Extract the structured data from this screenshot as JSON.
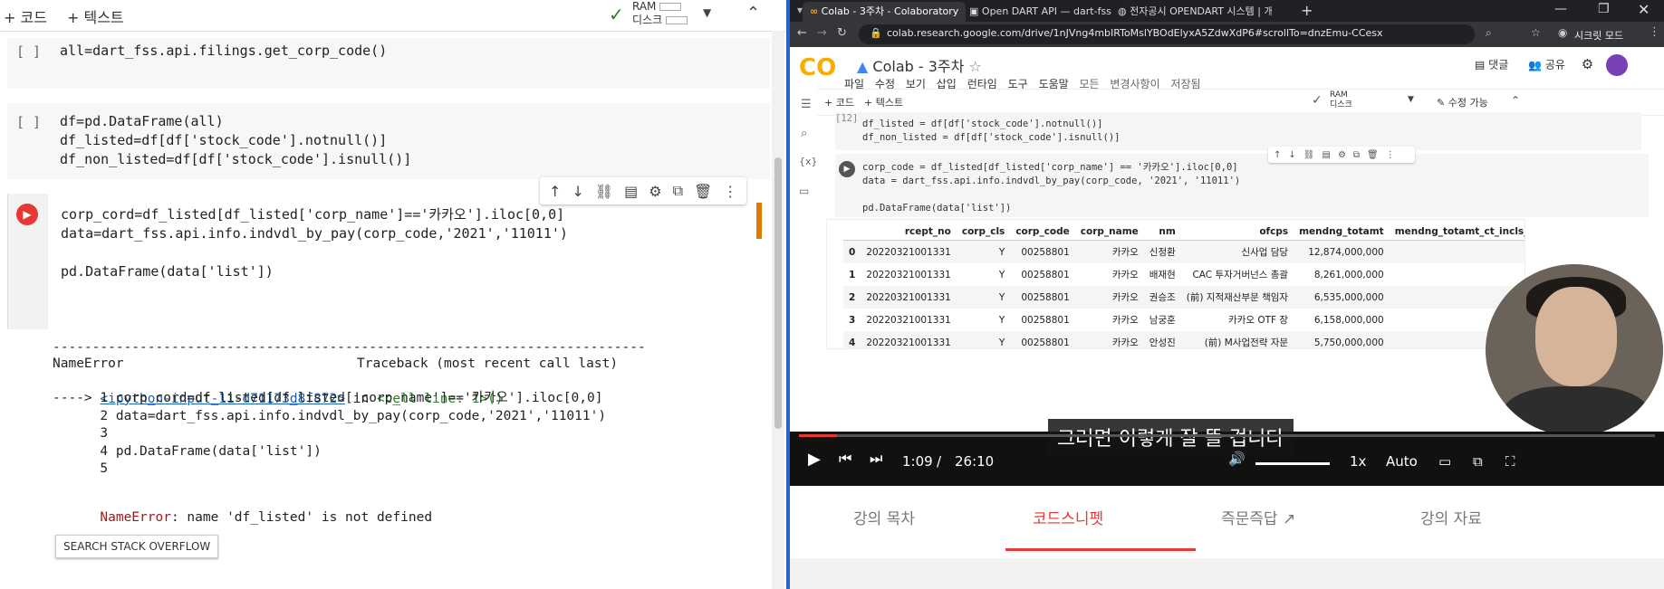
{
  "left": {
    "toolbar": {
      "add_code": "+ 코드",
      "add_text": "+ 텍스트",
      "ram": "RAM",
      "disk": "디스크"
    },
    "cells": [
      {
        "gutter": "[ ]",
        "code": "all=dart_fss.api.filings.get_corp_code()"
      },
      {
        "gutter": "[ ]",
        "code": "df=pd.DataFrame(all)\ndf_listed=df[df['stock_code'].notnull()]\ndf_non_listed=df[df['stock_code'].isnull()]"
      },
      {
        "gutter": "",
        "code": "corp_cord=df_listed[df_listed['corp_name']=='카카오'].iloc[0,0]\ndata=dart_fss.api.info.indvdl_by_pay(corp_code,'2021','11011')\n\npd.DataFrame(data['list'])"
      }
    ],
    "error": {
      "dashes": "---------------------------------------------------------------------------",
      "name": "NameError",
      "traceback": "Traceback (most recent call last)",
      "location": "<ipython-input-11-d71173d8f872>",
      "in": " in ",
      "cell_line": "<cell line: 1>()",
      "lines": [
        "----> 1 corp_cord=df_listed[df_listed['corp_name']=='카카오'].iloc[0,0]",
        "      2 data=dart_fss.api.info.indvdl_by_pay(corp_code,'2021','11011')",
        "      3",
        "      4 pd.DataFrame(data['list'])",
        "      5"
      ],
      "message_prefix": "NameError",
      "message": ": name 'df_listed' is not defined"
    },
    "search_stack_overflow": "SEARCH STACK OVERFLOW"
  },
  "right": {
    "tabs": [
      {
        "label": "Colab - 3주차 - Colaboratory"
      },
      {
        "label": "Open DART API — dart-fss doc"
      },
      {
        "label": "전자공시 OPENDART 시스템 | 개"
      }
    ],
    "url": "colab.research.google.com/drive/1nJVng4mbIRToMslYBOdElyxA5ZdwXdP6#scrollTo=dnzEmu-CCesx",
    "secret_mode": "시크릿 모드",
    "colab": {
      "logo": "CO",
      "title": "Colab - 3주차",
      "menu": [
        "파일",
        "수정",
        "보기",
        "삽입",
        "런타임",
        "도구",
        "도움말",
        "모든 변경사항이 저장됨"
      ],
      "comment": "댓글",
      "share": "공유",
      "add_code": "+ 코드",
      "add_text": "+ 텍스트",
      "ram": "RAM",
      "disk": "디스크",
      "edit_mode": "수정 가능",
      "cell1_num": "[12]",
      "cell1_code": "df_listed = df[df['stock_code'].notnull()]\ndf_non_listed = df[df['stock_code'].isnull()]",
      "cell2_code": "corp_code = df_listed[df_listed['corp_name'] == '카카오'].iloc[0,0]\ndata = dart_fss.api.info.indvdl_by_pay(corp_code, '2021', '11011')\n\npd.DataFrame(data['list'])",
      "table": {
        "columns": [
          "",
          "rcept_no",
          "corp_cls",
          "corp_code",
          "corp_name",
          "nm",
          "ofcps",
          "mendng_totamt",
          "mendng_totamt_ct_incls_mendng"
        ],
        "rows": [
          [
            "0",
            "20220321001331",
            "Y",
            "00258801",
            "카카오",
            "신정환",
            "신사업 담당",
            "12,874,000,000",
            "-"
          ],
          [
            "1",
            "20220321001331",
            "Y",
            "00258801",
            "카카오",
            "배재현",
            "CAC 투자거버넌스 총괄",
            "8,261,000,000",
            ""
          ],
          [
            "2",
            "20220321001331",
            "Y",
            "00258801",
            "카카오",
            "권승조",
            "(前) 지적재산부문 책임자",
            "6,535,000,000",
            ""
          ],
          [
            "3",
            "20220321001331",
            "Y",
            "00258801",
            "카카오",
            "남궁훈",
            "카카오 OTF 장",
            "6,158,000,000",
            ""
          ],
          [
            "4",
            "20220321001331",
            "Y",
            "00258801",
            "카카오",
            "안성진",
            "(前) M사업전략 자문",
            "5,750,000,000",
            ""
          ]
        ]
      }
    },
    "player": {
      "caption": "그러면 이렇게 잘 뜰 겁니다",
      "current_time": "1:09",
      "separator": "/",
      "duration": "26:10",
      "speed": "1x",
      "quality": "Auto",
      "progress": 0.044
    },
    "lecture_tabs": [
      "강의 목차",
      "코드스니펫",
      "즉문즉답",
      "강의 자료"
    ]
  }
}
